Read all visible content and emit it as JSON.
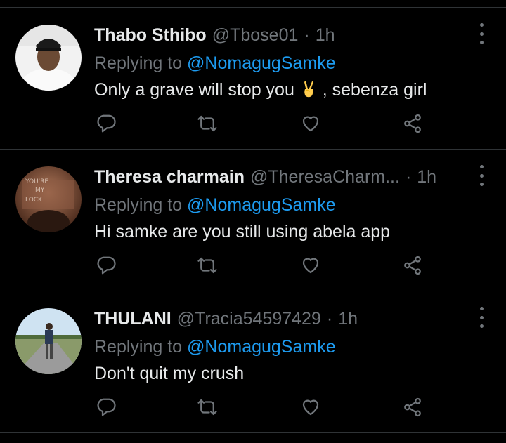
{
  "replies": [
    {
      "name": "Thabo Sthibo",
      "handle": "@Tbose01",
      "time": "1h",
      "replying_label": "Replying to",
      "replying_to": "@NomagugSamke",
      "text_before_emoji": "Only a grave will stop you",
      "emoji": "victory-hand",
      "text_after_emoji": " , sebenza girl"
    },
    {
      "name": "Theresa charmain",
      "handle": "@TheresaCharm...",
      "time": "1h",
      "replying_label": "Replying to",
      "replying_to": "@NomagugSamke",
      "text": "Hi samke are you still using abela app"
    },
    {
      "name": "THULANI",
      "handle": "@Tracia54597429",
      "time": "1h",
      "replying_label": "Replying to",
      "replying_to": "@NomagugSamke",
      "text": "Don't quit my crush"
    }
  ],
  "separator": "·",
  "colors": {
    "background": "#000000",
    "text": "#e7e9ea",
    "muted": "#71767b",
    "link": "#1d9bf0",
    "divider": "#2f3336"
  },
  "icons": [
    "reply-icon",
    "retweet-icon",
    "like-icon",
    "share-icon",
    "more-options-icon"
  ]
}
